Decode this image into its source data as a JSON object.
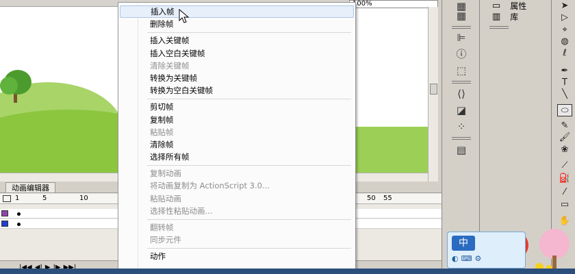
{
  "stage": {
    "zoom": "100%"
  },
  "timeline": {
    "tab_label": "动画编辑器",
    "ruler_left": [
      "1",
      "5",
      "10"
    ],
    "ruler_right": [
      "50",
      "55"
    ]
  },
  "context_menu": {
    "items": [
      {
        "label": "插入帧",
        "enabled": true,
        "hover": true
      },
      {
        "label": "删除帧",
        "enabled": true
      },
      {
        "sep": true
      },
      {
        "label": "插入关键帧",
        "enabled": true
      },
      {
        "label": "插入空白关键帧",
        "enabled": true
      },
      {
        "label": "清除关键帧",
        "enabled": false
      },
      {
        "label": "转换为关键帧",
        "enabled": true
      },
      {
        "label": "转换为空白关键帧",
        "enabled": true
      },
      {
        "sep": true
      },
      {
        "label": "剪切帧",
        "enabled": true
      },
      {
        "label": "复制帧",
        "enabled": true
      },
      {
        "label": "粘贴帧",
        "enabled": false
      },
      {
        "label": "清除帧",
        "enabled": true
      },
      {
        "label": "选择所有帧",
        "enabled": true
      },
      {
        "sep": true
      },
      {
        "label": "复制动画",
        "enabled": false
      },
      {
        "label": "将动画复制为 ActionScript 3.0...",
        "enabled": false
      },
      {
        "label": "粘贴动画",
        "enabled": false
      },
      {
        "label": "选择性粘贴动画...",
        "enabled": false
      },
      {
        "sep": true
      },
      {
        "label": "翻转帧",
        "enabled": false
      },
      {
        "label": "同步元件",
        "enabled": false
      },
      {
        "sep": true
      },
      {
        "label": "动作",
        "enabled": true
      }
    ]
  },
  "library_panel": {
    "properties_label": "属性",
    "library_label": "库"
  },
  "ime": {
    "mode_label": "中"
  }
}
